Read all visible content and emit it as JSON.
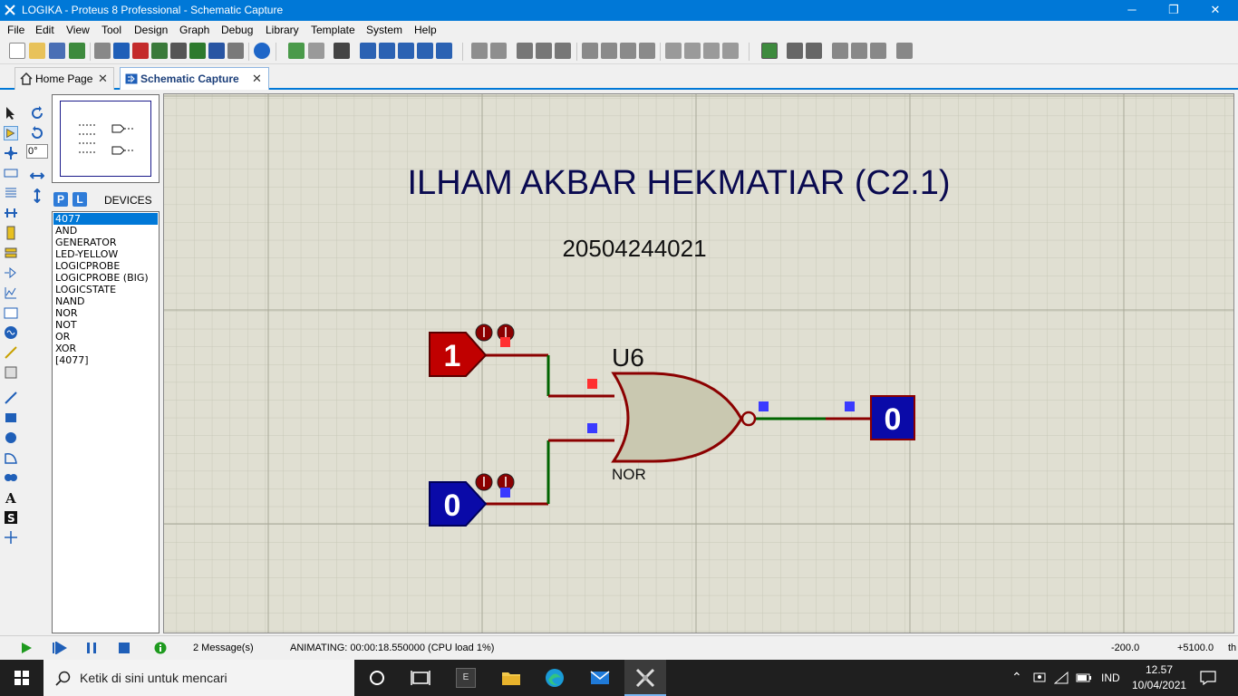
{
  "window": {
    "title": "LOGIKA - Proteus 8 Professional - Schematic Capture",
    "minimize": "─",
    "restore": "❐",
    "close": "✕"
  },
  "menu": [
    "File",
    "Edit",
    "View",
    "Tool",
    "Design",
    "Graph",
    "Debug",
    "Library",
    "Template",
    "System",
    "Help"
  ],
  "tabs": [
    {
      "label": "Home Page",
      "close": "✕"
    },
    {
      "label": "Schematic Capture",
      "close": "✕"
    }
  ],
  "rotation": "0°",
  "devices": {
    "p_label": "P",
    "l_label": "L",
    "title": "DEVICES",
    "items": [
      "4077",
      "AND",
      "GENERATOR",
      "LED-YELLOW",
      "LOGICPROBE",
      "LOGICPROBE (BIG)",
      "LOGICSTATE",
      "NAND",
      "NOR",
      "NOT",
      "OR",
      "XOR",
      "[4077]"
    ],
    "selected_index": 0
  },
  "schematic": {
    "title": "ILHAM AKBAR HEKMATIAR (C2.1)",
    "subtitle": "20504244021",
    "input_a_value": "1",
    "input_b_value": "0",
    "gate_ref": "U6",
    "gate_type": "NOR",
    "output_value": "0",
    "colors": {
      "high": "#c00000",
      "low": "#0a0aa8",
      "wire_high": "#8b0000",
      "wire_green": "#006400",
      "gate_fill": "#c9c8b0",
      "grid_bg": "#e0dfd2"
    }
  },
  "status": {
    "messages": "2 Message(s)",
    "animating": "ANIMATING: 00:00:18.550000 (CPU load 1%)",
    "coord_x": "-200.0",
    "coord_y": "+5100.0",
    "unit": "th"
  },
  "taskbar": {
    "search_placeholder": "Ketik di sini untuk mencari",
    "e_label": "E",
    "language": "IND",
    "time": "12.57",
    "date": "10/04/2021"
  }
}
